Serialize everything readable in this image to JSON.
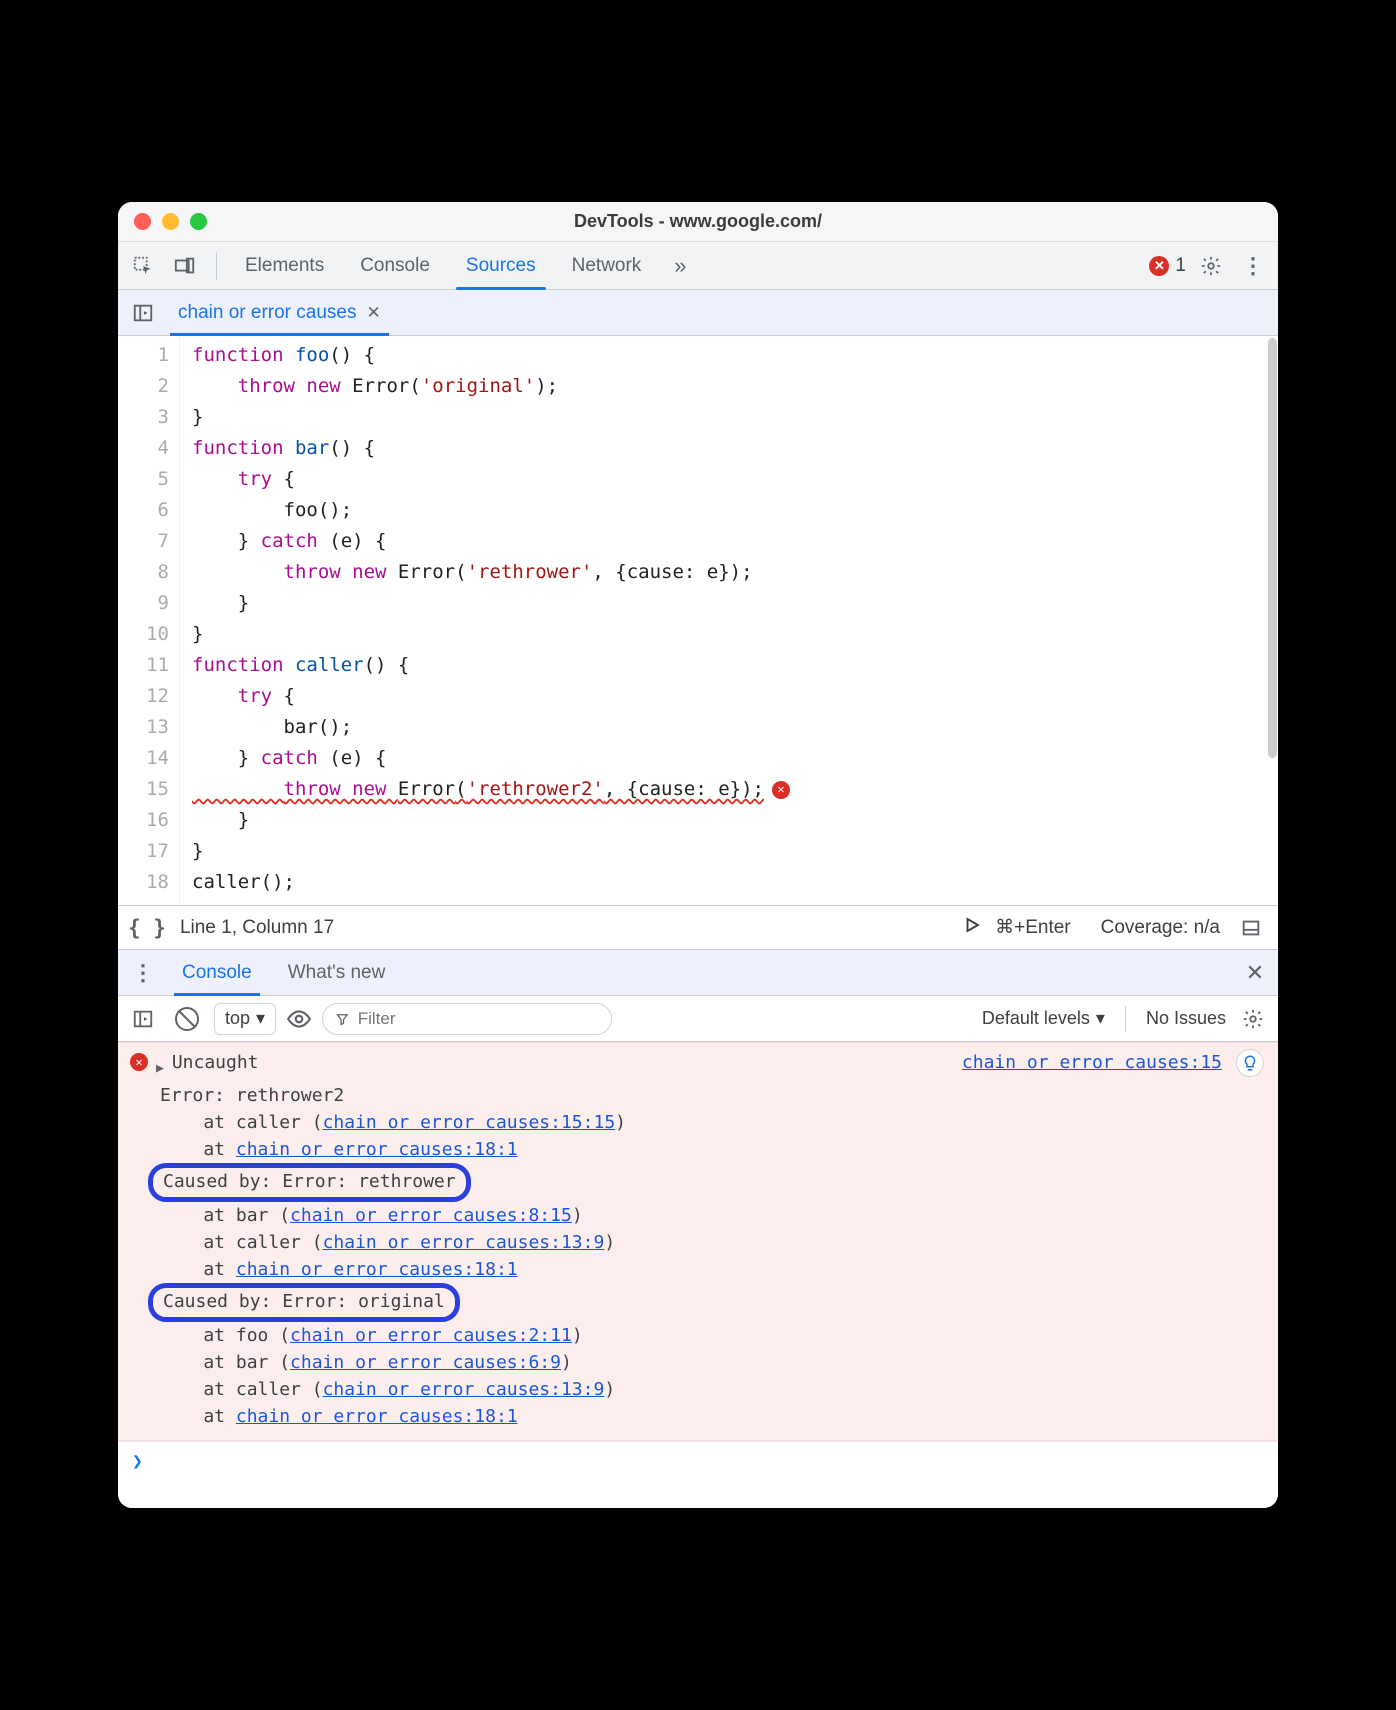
{
  "window_title": "DevTools - www.google.com/",
  "top_tabs": {
    "items": [
      "Elements",
      "Console",
      "Sources",
      "Network"
    ],
    "active": "Sources",
    "error_count": "1"
  },
  "file_tab": {
    "name": "chain or error causes"
  },
  "editor": {
    "lines": [
      {
        "n": "1",
        "segs": [
          [
            "kw2",
            "function "
          ],
          [
            "fnname",
            "foo"
          ],
          [
            "punc",
            "() {"
          ]
        ]
      },
      {
        "n": "2",
        "segs": [
          [
            "plain",
            "    "
          ],
          [
            "kw2",
            "throw new "
          ],
          [
            "type",
            "Error"
          ],
          [
            "punc",
            "("
          ],
          [
            "str",
            "'original'"
          ],
          [
            "punc",
            ");"
          ]
        ]
      },
      {
        "n": "3",
        "segs": [
          [
            "punc",
            "}"
          ]
        ]
      },
      {
        "n": "4",
        "segs": [
          [
            "kw2",
            "function "
          ],
          [
            "fnname",
            "bar"
          ],
          [
            "punc",
            "() {"
          ]
        ]
      },
      {
        "n": "5",
        "segs": [
          [
            "plain",
            "    "
          ],
          [
            "kw2",
            "try"
          ],
          [
            "punc",
            " {"
          ]
        ]
      },
      {
        "n": "6",
        "segs": [
          [
            "plain",
            "        "
          ],
          [
            "plain",
            "foo();"
          ]
        ]
      },
      {
        "n": "7",
        "segs": [
          [
            "plain",
            "    } "
          ],
          [
            "kw2",
            "catch"
          ],
          [
            "punc",
            " (e) {"
          ]
        ]
      },
      {
        "n": "8",
        "segs": [
          [
            "plain",
            "        "
          ],
          [
            "kw2",
            "throw new "
          ],
          [
            "type",
            "Error"
          ],
          [
            "punc",
            "("
          ],
          [
            "str",
            "'rethrower'"
          ],
          [
            "punc",
            ", {cause: e});"
          ]
        ]
      },
      {
        "n": "9",
        "segs": [
          [
            "plain",
            "    }"
          ]
        ]
      },
      {
        "n": "10",
        "segs": [
          [
            "punc",
            "}"
          ]
        ]
      },
      {
        "n": "11",
        "segs": [
          [
            "kw2",
            "function "
          ],
          [
            "fnname",
            "caller"
          ],
          [
            "punc",
            "() {"
          ]
        ]
      },
      {
        "n": "12",
        "segs": [
          [
            "plain",
            "    "
          ],
          [
            "kw2",
            "try"
          ],
          [
            "punc",
            " {"
          ]
        ]
      },
      {
        "n": "13",
        "segs": [
          [
            "plain",
            "        "
          ],
          [
            "plain",
            "bar();"
          ]
        ]
      },
      {
        "n": "14",
        "segs": [
          [
            "plain",
            "    } "
          ],
          [
            "kw2",
            "catch"
          ],
          [
            "punc",
            " (e) {"
          ]
        ]
      },
      {
        "n": "15",
        "segs": [
          [
            "plain",
            "        "
          ],
          [
            "kw2",
            "throw new "
          ],
          [
            "type",
            "Error"
          ],
          [
            "punc",
            "("
          ],
          [
            "str",
            "'rethrower2'"
          ],
          [
            "punc",
            ", {cause: e});"
          ]
        ],
        "squiggle": true,
        "err": true
      },
      {
        "n": "16",
        "segs": [
          [
            "plain",
            "    }"
          ]
        ]
      },
      {
        "n": "17",
        "segs": [
          [
            "punc",
            "}"
          ]
        ]
      },
      {
        "n": "18",
        "segs": [
          [
            "plain",
            "caller();"
          ]
        ]
      }
    ]
  },
  "statusbar": {
    "pos": "Line 1, Column 17",
    "shortcut": "⌘+Enter",
    "coverage": "Coverage: n/a"
  },
  "drawer": {
    "tabs": [
      "Console",
      "What's new"
    ],
    "active": "Console"
  },
  "console_toolbar": {
    "context": "top",
    "filter_placeholder": "Filter",
    "levels": "Default levels",
    "issues": "No Issues"
  },
  "console_error": {
    "origin_link": "chain or error causes:15",
    "head": "Uncaught",
    "title": "Error: rethrower2",
    "stack1": [
      {
        "pre": "    at caller (",
        "link": "chain or error causes:15:15",
        "post": ")"
      },
      {
        "pre": "    at ",
        "link": "chain or error causes:18:1",
        "post": ""
      }
    ],
    "cause1": "Caused by: Error: rethrower",
    "stack2": [
      {
        "pre": "    at bar (",
        "link": "chain or error causes:8:15",
        "post": ")"
      },
      {
        "pre": "    at caller (",
        "link": "chain or error causes:13:9",
        "post": ")"
      },
      {
        "pre": "    at ",
        "link": "chain or error causes:18:1",
        "post": ""
      }
    ],
    "cause2": "Caused by: Error: original",
    "stack3": [
      {
        "pre": "    at foo (",
        "link": "chain or error causes:2:11",
        "post": ")"
      },
      {
        "pre": "    at bar (",
        "link": "chain or error causes:6:9",
        "post": ")"
      },
      {
        "pre": "    at caller (",
        "link": "chain or error causes:13:9",
        "post": ")"
      },
      {
        "pre": "    at ",
        "link": "chain or error causes:18:1",
        "post": ""
      }
    ]
  }
}
